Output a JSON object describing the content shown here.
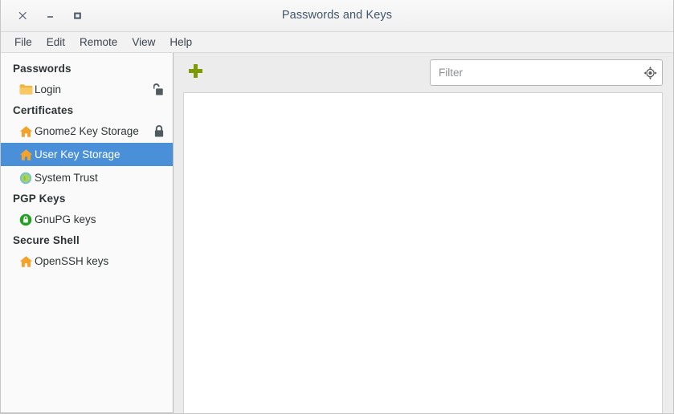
{
  "window": {
    "title": "Passwords and Keys",
    "controls": [
      {
        "name": "close-button",
        "glyph": "close"
      },
      {
        "name": "minimize-button",
        "glyph": "minimize"
      },
      {
        "name": "maximize-button",
        "glyph": "maximize"
      }
    ]
  },
  "menubar": {
    "items": [
      {
        "label": "File"
      },
      {
        "label": "Edit"
      },
      {
        "label": "Remote"
      },
      {
        "label": "View"
      },
      {
        "label": "Help"
      }
    ]
  },
  "sidebar": {
    "sections": [
      {
        "header": "Passwords",
        "items": [
          {
            "label": "Login",
            "icon": "folder-icon",
            "lock": "unlocked-padlock-icon",
            "selected": false
          }
        ]
      },
      {
        "header": "Certificates",
        "items": [
          {
            "label": "Gnome2 Key Storage",
            "icon": "home-icon",
            "lock": "locked-padlock-icon",
            "selected": false
          },
          {
            "label": "User Key Storage",
            "icon": "home-icon",
            "lock": null,
            "selected": true
          },
          {
            "label": "System Trust",
            "icon": "certificate-seal-icon",
            "lock": null,
            "selected": false
          }
        ]
      },
      {
        "header": "PGP Keys",
        "items": [
          {
            "label": "GnuPG keys",
            "icon": "green-lock-badge-icon",
            "lock": null,
            "selected": false
          }
        ]
      },
      {
        "header": "Secure Shell",
        "items": [
          {
            "label": "OpenSSH keys",
            "icon": "home-icon",
            "lock": null,
            "selected": false
          }
        ]
      }
    ]
  },
  "toolbar": {
    "add_icon": "plus-icon",
    "filter": {
      "value": "",
      "placeholder": "Filter",
      "icon": "target-locate-icon"
    }
  },
  "content": {
    "items": []
  },
  "colors": {
    "selection": "#4a90d9",
    "add_plus": "#7d9a03",
    "folder": "#f0b53e",
    "home": "#f3a32a",
    "gnupg_green": "#24a124",
    "title_text": "#41576b"
  }
}
